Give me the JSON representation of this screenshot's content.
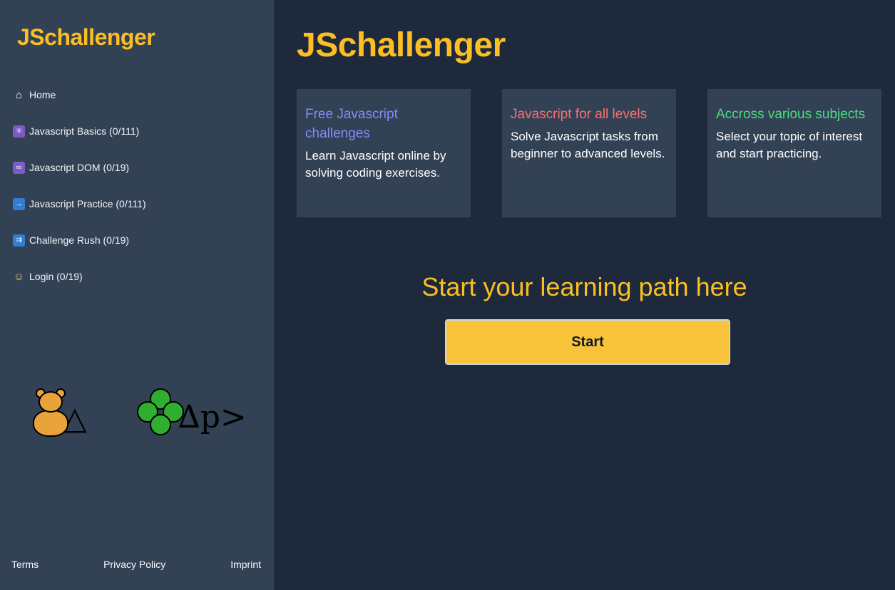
{
  "sidebar": {
    "logo": "JSchallenger",
    "items": [
      {
        "label": "Home",
        "icon": "home-icon"
      },
      {
        "label": "Javascript Basics (0/111)",
        "icon": "atom-icon"
      },
      {
        "label": "Javascript DOM (0/19)",
        "icon": "infinity-icon"
      },
      {
        "label": "Javascript Practice (0/111)",
        "icon": "arrow-right-icon"
      },
      {
        "label": "Challenge Rush (0/19)",
        "icon": "rush-icon"
      },
      {
        "label": "Login (0/19)",
        "icon": "person-icon"
      }
    ],
    "footer": {
      "terms": "Terms",
      "privacy": "Privacy Policy",
      "imprint": "Imprint"
    },
    "deco_text_1": "△",
    "deco_text_2": "∆p>"
  },
  "main": {
    "title": "JSchallenger",
    "cards": [
      {
        "title": "Free Javascript challenges",
        "body": "Learn Javascript online by solving coding exercises.",
        "color": "#818cf8"
      },
      {
        "title": "Javascript for all levels",
        "body": "Solve Javascript tasks from beginner to advanced levels.",
        "color": "#f87171"
      },
      {
        "title": "Accross various subjects",
        "body": "Select your topic of interest and start practicing.",
        "color": "#4ade80"
      }
    ],
    "cta_heading": "Start your learning path here",
    "start_label": "Start"
  }
}
